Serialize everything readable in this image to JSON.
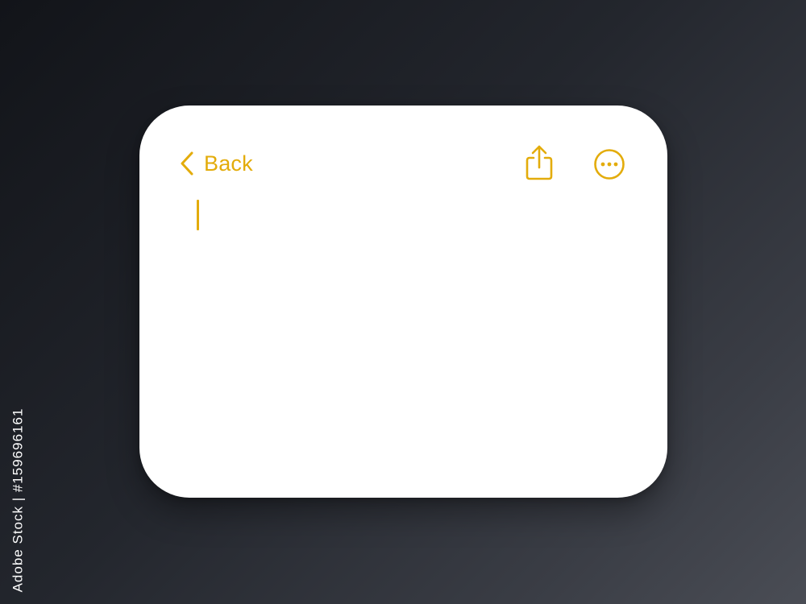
{
  "theme": {
    "accent": "#E3AC0B",
    "card_background": "#FFFFFF"
  },
  "nav": {
    "back_label": "Back",
    "back_icon": "chevron-left-icon",
    "share_icon": "share-icon",
    "more_icon": "ellipsis-circle-icon"
  },
  "editor": {
    "text": "",
    "cursor": "text-cursor"
  },
  "watermark": {
    "text": "Adobe Stock",
    "id": "Adobe Stock | #159696161"
  }
}
